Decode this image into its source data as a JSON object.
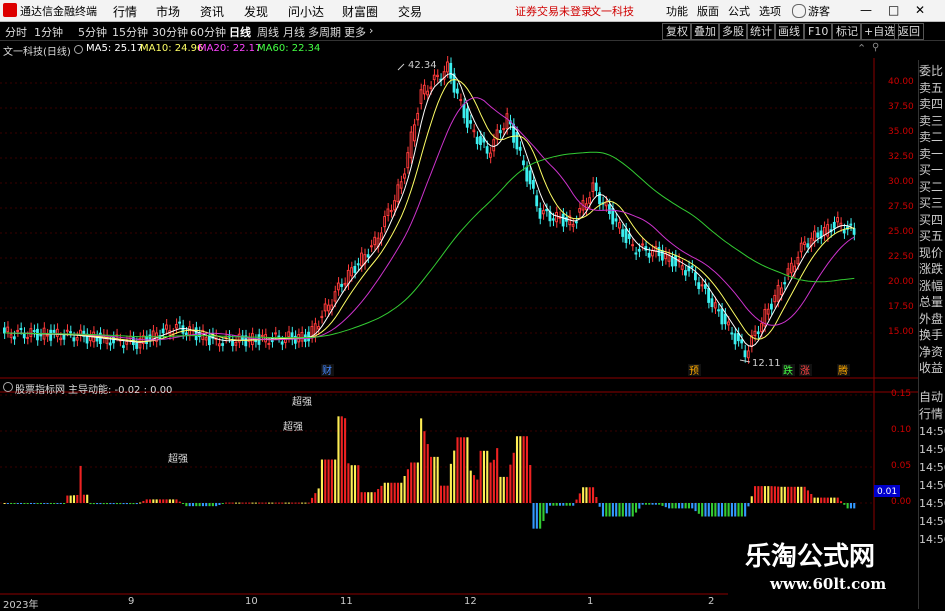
{
  "titlebar": {
    "app_title": "通达信金融终端",
    "menus": [
      "行情",
      "市场",
      "资讯",
      "发现",
      "问小达",
      "财富圈",
      "交易"
    ],
    "warning": "证券交易未登录",
    "stock": "文一科技",
    "right_menus": [
      "功能",
      "版面",
      "公式",
      "选项",
      "游客"
    ]
  },
  "toolbar": {
    "periods": [
      "分时",
      "1分钟",
      "5分钟",
      "15分钟",
      "30分钟",
      "60分钟",
      "日线",
      "周线",
      "月线",
      "多周期",
      "更多"
    ],
    "active": "日线",
    "right_buttons": [
      "复权",
      "叠加",
      "多股",
      "统计",
      "画线",
      "F10",
      "标记",
      "+自选",
      "返回"
    ]
  },
  "chart_header": {
    "name": "文一科技(日线)",
    "ma": [
      {
        "label": "MA5: 25.17",
        "color": "#ffffff"
      },
      {
        "label": "MA10: 24.96",
        "color": "#ffff66"
      },
      {
        "label": "MA20: 22.17",
        "color": "#ff44ff"
      },
      {
        "label": "MA60: 22.34",
        "color": "#44ff44"
      }
    ]
  },
  "main_chart": {
    "y_ticks": [
      "40.00",
      "37.50",
      "35.00",
      "32.50",
      "30.00",
      "27.50",
      "25.00",
      "22.50",
      "20.00",
      "17.50",
      "15.00"
    ],
    "high_label": "42.34",
    "low_label": "12.11",
    "markers": [
      {
        "text": "财",
        "color": "#4488ff"
      },
      {
        "text": "预",
        "color": "#ffaa00"
      },
      {
        "text": "跌",
        "color": "#44ff44"
      },
      {
        "text": "涨",
        "color": "#ff4444"
      },
      {
        "text": "腾",
        "color": "#ffaa00"
      }
    ]
  },
  "indicator": {
    "name": "股票指标网",
    "main_label": "主导动能: -0.02 : 0.00",
    "y_ticks": [
      "0.15",
      "0.10",
      "0.05",
      "0.00"
    ],
    "current_value": "0.01",
    "annotations": [
      "超强",
      "超强",
      "超强"
    ]
  },
  "right_panel": {
    "items": [
      "委比",
      "卖五",
      "卖四",
      "卖三",
      "卖二",
      "卖一",
      "买一",
      "买二",
      "买三",
      "买四",
      "买五",
      "现价",
      "涨跌",
      "涨幅",
      "总量",
      "外盘",
      "换手",
      "净资",
      "收益",
      "自动",
      "行情"
    ],
    "times": [
      "14:56",
      "14:56",
      "14:56",
      "14:56",
      "14:56",
      "14:56",
      "14:56"
    ]
  },
  "x_axis": [
    "2023年",
    "9",
    "10",
    "11",
    "12",
    "1",
    "2"
  ],
  "watermark": {
    "title": "乐淘公式网",
    "url": "www.60lt.com"
  }
}
